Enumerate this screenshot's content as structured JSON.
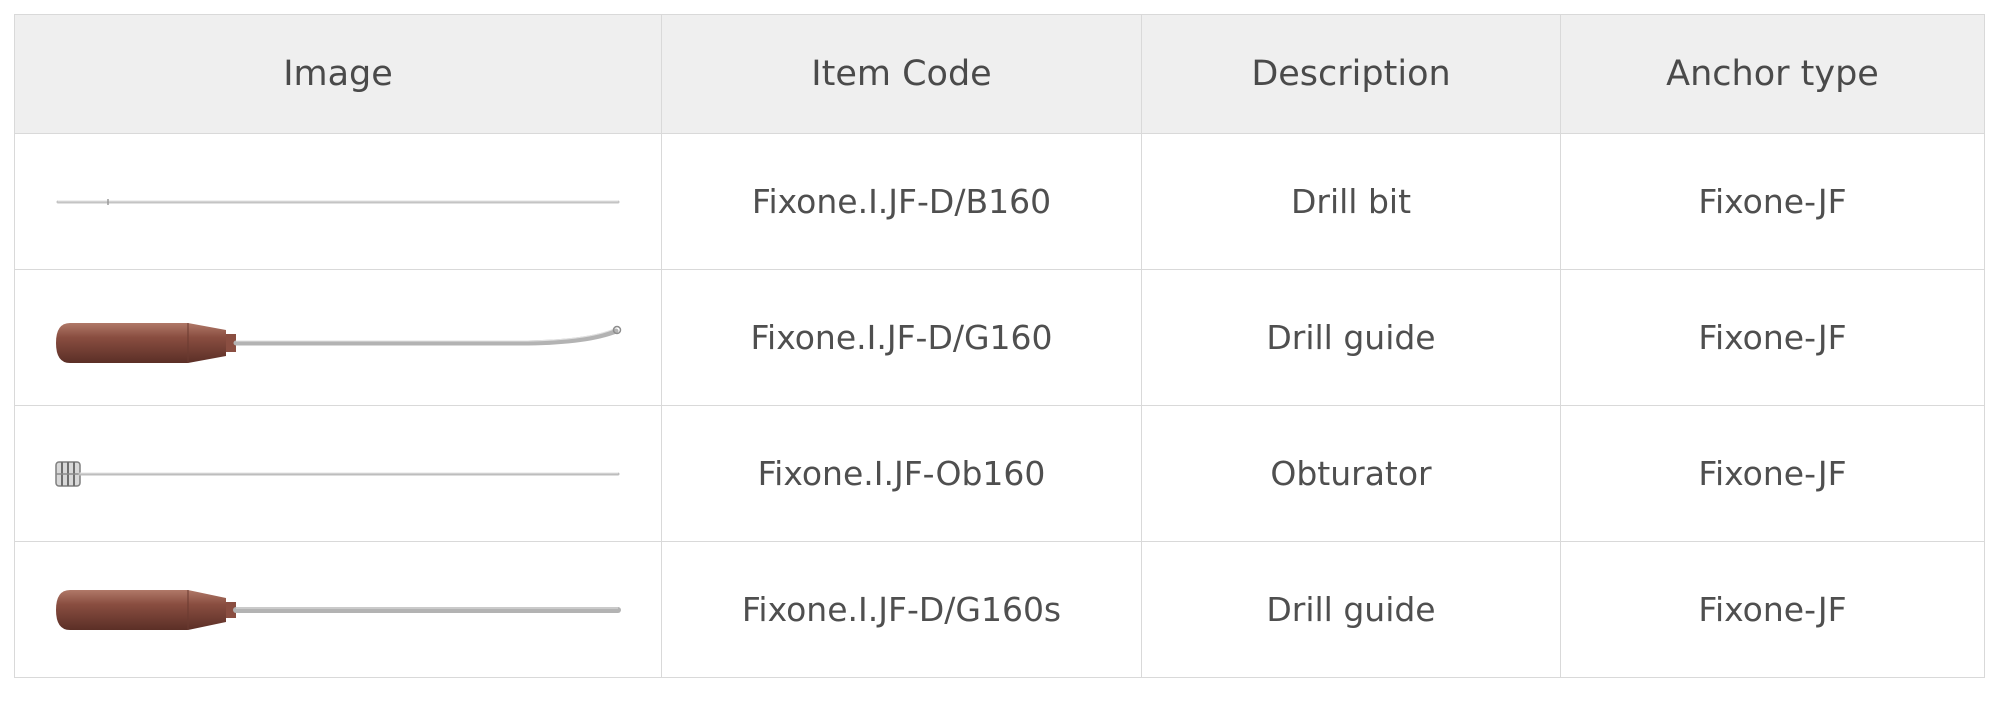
{
  "table": {
    "headers": {
      "image": "Image",
      "item_code": "Item Code",
      "description": "Description",
      "anchor_type": "Anchor type"
    },
    "rows": [
      {
        "image_icon": "drill-bit-image",
        "item_code": "Fixone.I.JF-D/B160",
        "description": "Drill bit",
        "anchor_type": "Fixone-JF"
      },
      {
        "image_icon": "drill-guide-curved-image",
        "item_code": "Fixone.I.JF-D/G160",
        "description": "Drill guide",
        "anchor_type": "Fixone-JF"
      },
      {
        "image_icon": "obturator-image",
        "item_code": "Fixone.I.JF-Ob160",
        "description": "Obturator",
        "anchor_type": "Fixone-JF"
      },
      {
        "image_icon": "drill-guide-straight-image",
        "item_code": "Fixone.I.JF-D/G160s",
        "description": "Drill guide",
        "anchor_type": "Fixone-JF"
      }
    ]
  },
  "colors": {
    "border": "#d9d9d9",
    "header_background": "#efefef",
    "handle_bronze": "#8a4e41",
    "shaft_steel": "#b8b8b8"
  }
}
